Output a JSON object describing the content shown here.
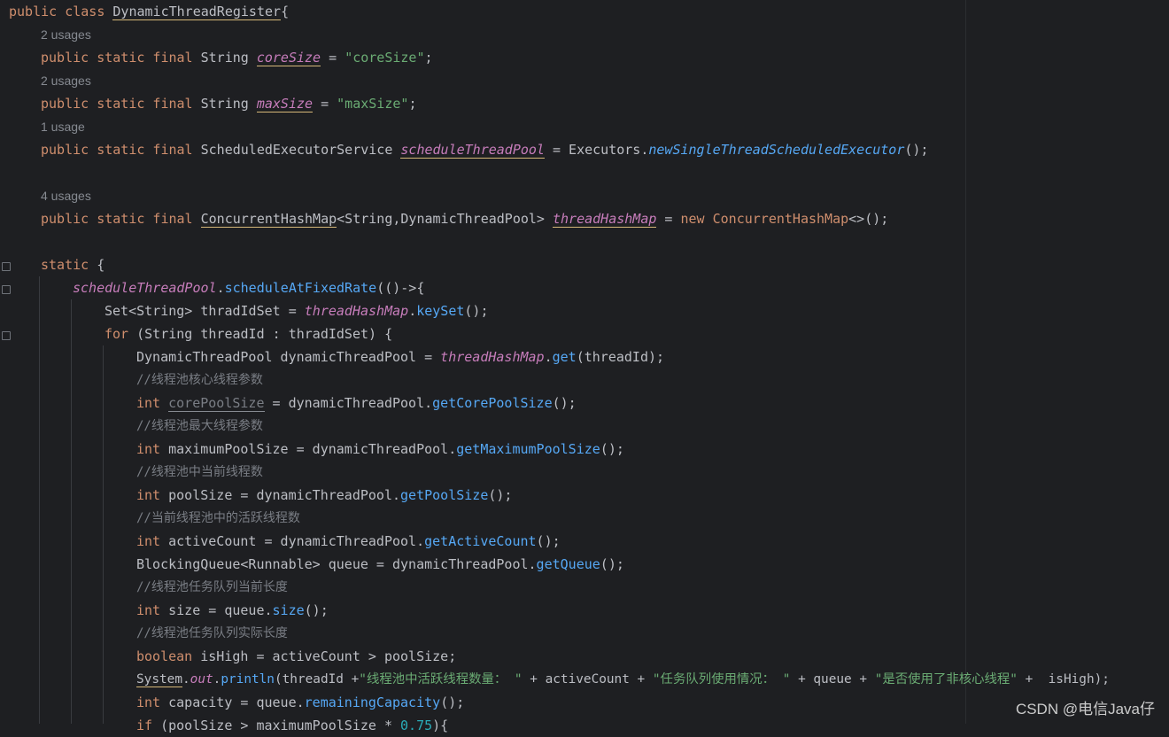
{
  "editor": {
    "colors": {
      "background": "#1e1f22",
      "keyword": "#cf8e6d",
      "string": "#6aab73",
      "field": "#c77dbb",
      "method": "#56a8f5",
      "comment": "#7a7e85"
    },
    "hints": {
      "h1": "2 usages",
      "h2": "2 usages",
      "h3": "1 usage",
      "h4": "4 usages"
    },
    "code": {
      "l1_a": "public class ",
      "l1_b": "DynamicThreadRegister",
      "l1_c": "{",
      "l2_kw": "public static final ",
      "l2_type": "String ",
      "l2_name": "coreSize",
      "l2_eq": " = ",
      "l2_val": "\"coreSize\"",
      "l2_end": ";",
      "l3_kw": "public static final ",
      "l3_type": "String ",
      "l3_name": "maxSize",
      "l3_eq": " = ",
      "l3_val": "\"maxSize\"",
      "l3_end": ";",
      "l4_kw": "public static final ",
      "l4_type": "ScheduledExecutorService ",
      "l4_name": "scheduleThreadPool",
      "l4_eq": " = Executors.",
      "l4_call": "newSingleThreadScheduledExecutor",
      "l4_end": "();",
      "l5_kw": "public static final ",
      "l5_type": "ConcurrentHashMap",
      "l5_gen": "<String,DynamicThreadPool> ",
      "l5_name": "threadHashMap",
      "l5_eq": " = ",
      "l5_new": "new ",
      "l5_ctor": "ConcurrentHashMap",
      "l5_end": "<>();",
      "l6_kw": "static",
      "l6_end": " {",
      "l7_a": "scheduleThreadPool",
      "l7_b": ".",
      "l7_c": "scheduleAtFixedRate",
      "l7_d": "(()->{",
      "l8_a": "Set<String> thradIdSet = ",
      "l8_b": "threadHashMap",
      "l8_c": ".",
      "l8_d": "keySet",
      "l8_e": "();",
      "l9_kw": "for",
      "l9_rest": " (String threadId : thradIdSet) {",
      "l10_a": "DynamicThreadPool dynamicThreadPool = ",
      "l10_b": "threadHashMap",
      "l10_c": ".",
      "l10_d": "get",
      "l10_e": "(threadId);",
      "c1": "//线程池核心线程参数",
      "l11_kw": "int ",
      "l11_name": "corePoolSize",
      "l11_rest": " = dynamicThreadPool.",
      "l11_m": "getCorePoolSize",
      "l11_end": "();",
      "c2": "//线程池最大线程参数",
      "l12_kw": "int ",
      "l12_rest": "maximumPoolSize = dynamicThreadPool.",
      "l12_m": "getMaximumPoolSize",
      "l12_end": "();",
      "c3": "//线程池中当前线程数",
      "l13_kw": "int ",
      "l13_rest": "poolSize = dynamicThreadPool.",
      "l13_m": "getPoolSize",
      "l13_end": "();",
      "c4": "//当前线程池中的活跃线程数",
      "l14_kw": "int ",
      "l14_rest": "activeCount = dynamicThreadPool.",
      "l14_m": "getActiveCount",
      "l14_end": "();",
      "l15_rest": "BlockingQueue<Runnable> queue = dynamicThreadPool.",
      "l15_m": "getQueue",
      "l15_end": "();",
      "c5": "//线程池任务队列当前长度",
      "l16_kw": "int ",
      "l16_rest": "size = queue.",
      "l16_m": "size",
      "l16_end": "();",
      "c6": "//线程池任务队列实际长度",
      "l17_kw": "boolean ",
      "l17_rest": "isHigh = activeCount > poolSize;",
      "l18_a": "System",
      "l18_b": ".",
      "l18_c": "out",
      "l18_d": ".",
      "l18_e": "println",
      "l18_f": "(threadId +",
      "l18_s1": "\"线程池中活跃线程数量： \"",
      "l18_g": " + activeCount + ",
      "l18_s2": "\"任务队列使用情况： \"",
      "l18_h": " + queue + ",
      "l18_s3": "\"是否使用了非核心线程\"",
      "l18_i": " +  isHigh);",
      "l19_kw": "int ",
      "l19_rest": "capacity = queue.",
      "l19_m": "remainingCapacity",
      "l19_end": "();",
      "l20_kw": "if ",
      "l20_rest": "(poolSize > maximumPoolSize * ",
      "l20_num": "0.75",
      "l20_end": "){"
    }
  },
  "watermark": "CSDN @电信Java仔"
}
